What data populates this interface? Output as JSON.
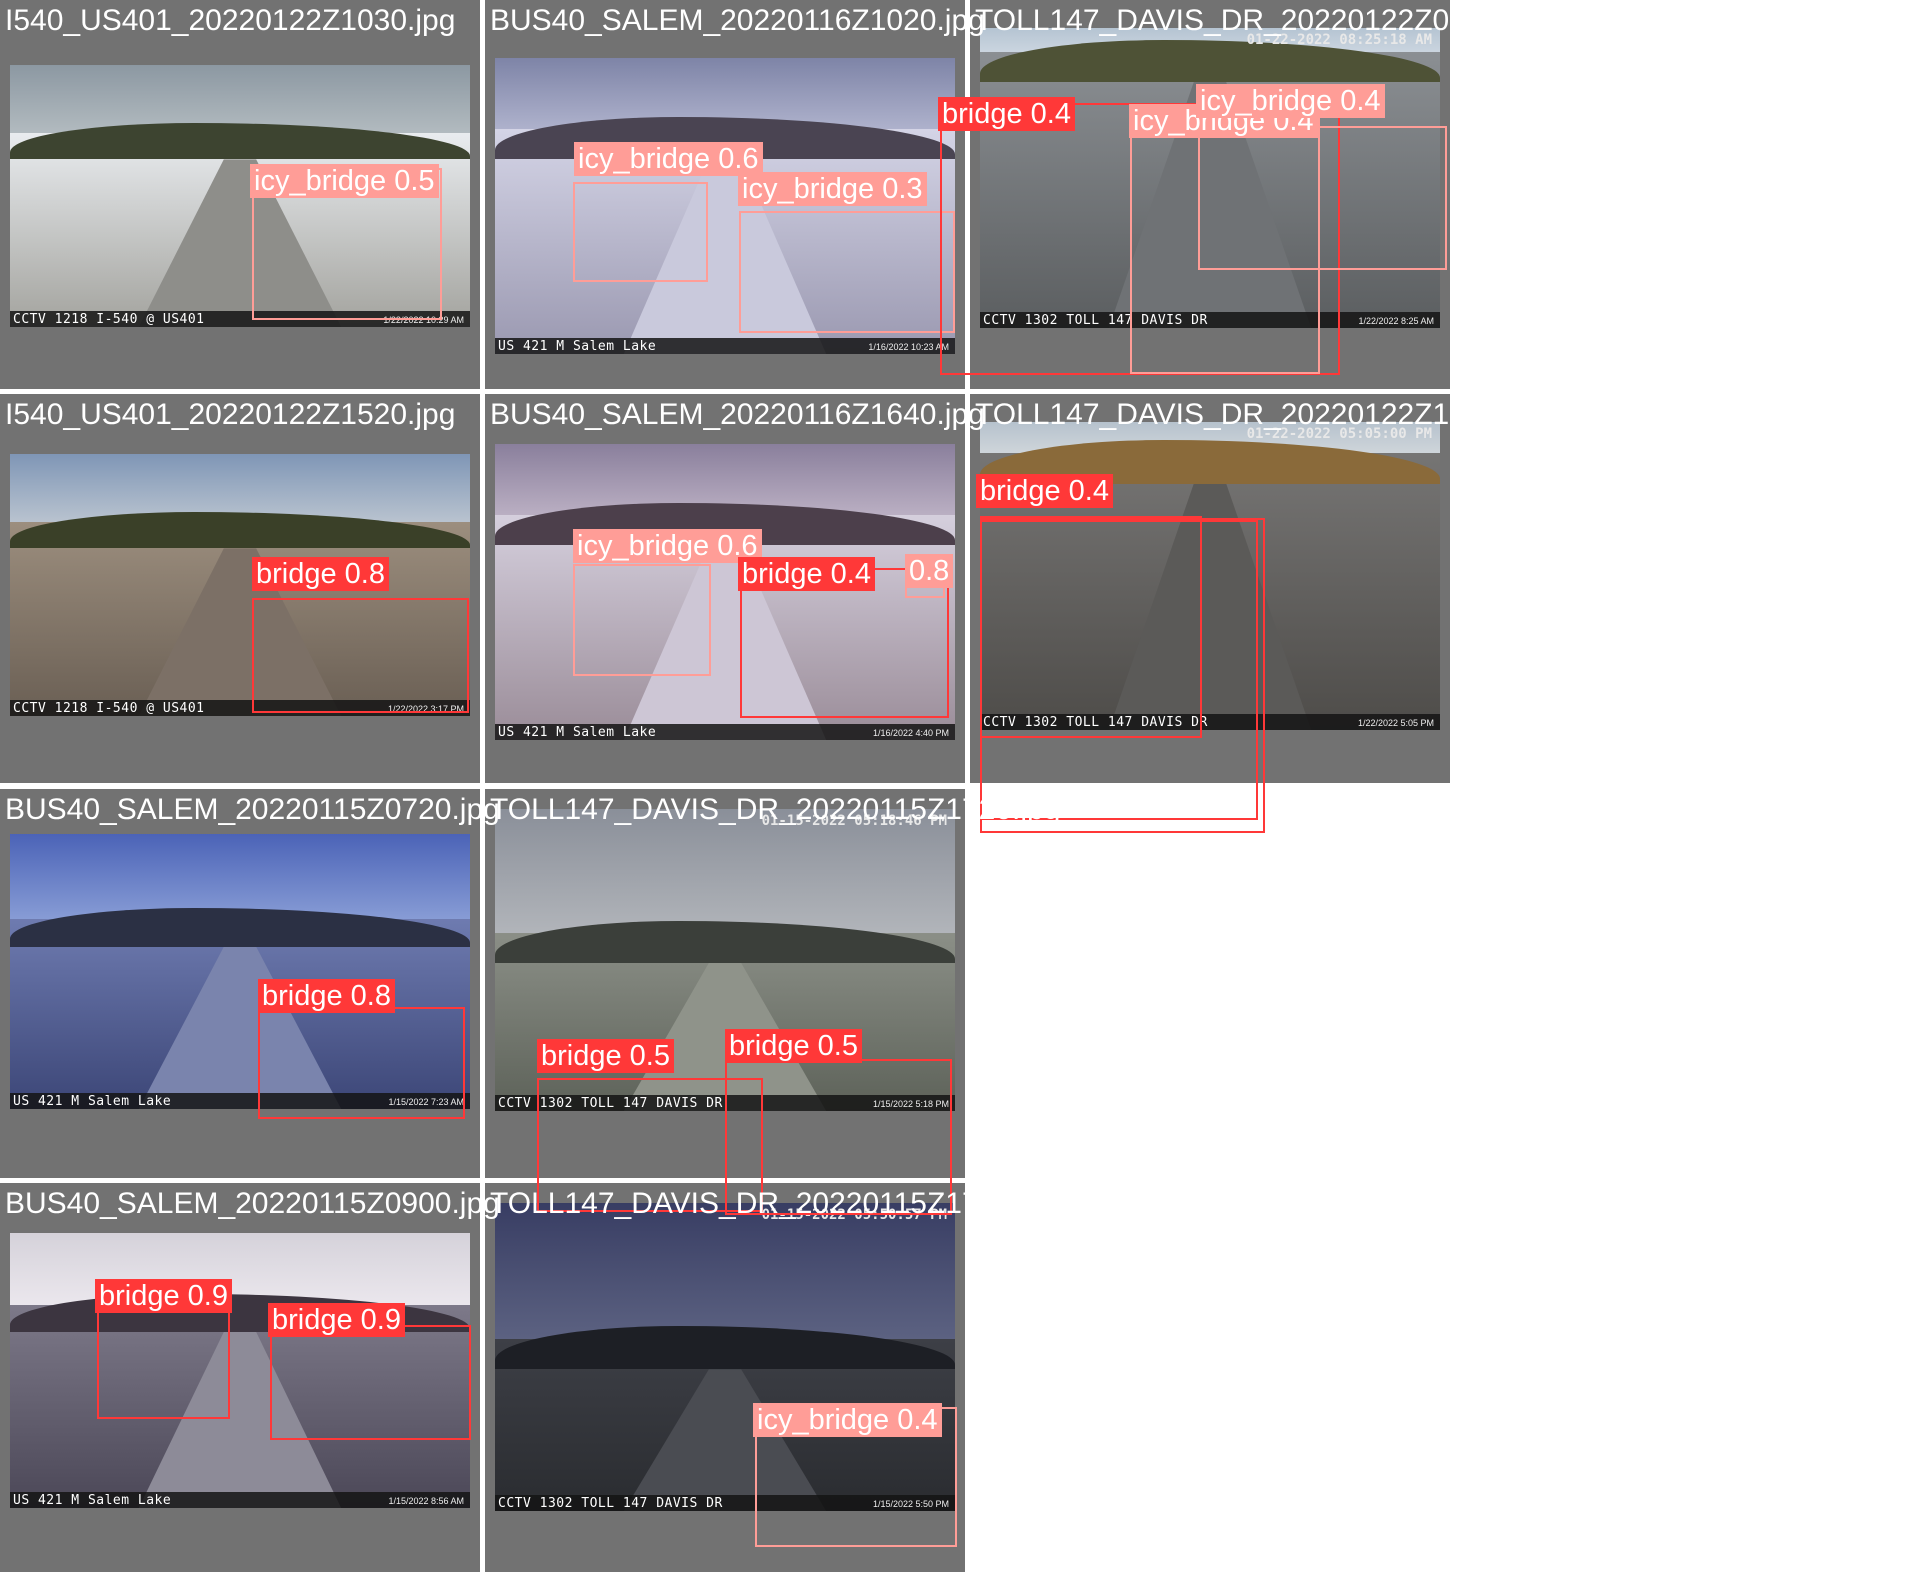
{
  "colors": {
    "bridge": "#ff3838",
    "icy_bridge": "#ff9d97",
    "tile_background": "#727272"
  },
  "tiles": [
    {
      "file": "I540_US401_20220122Z1030.jpg",
      "camera_label": "CCTV 1218 I-540 @ US401",
      "camera_time": "1/22/2022 10:29 AM",
      "camera_stamp": "",
      "detections": [
        {
          "label": "icy_bridge 0.5",
          "class": "icy_bridge",
          "confidence": 0.5
        }
      ]
    },
    {
      "file": "BUS40_SALEM_20220116Z1020.jpg",
      "camera_label": "US 421 M Salem Lake",
      "camera_time": "1/16/2022 10:23 AM",
      "camera_stamp": "",
      "detections": [
        {
          "label": "icy_bridge 0.6",
          "class": "icy_bridge",
          "confidence": 0.6
        },
        {
          "label": "icy_bridge 0.3",
          "class": "icy_bridge",
          "confidence": 0.3
        }
      ]
    },
    {
      "file": "TOLL147_DAVIS_DR_20220122Z0830.jpg",
      "camera_label": "CCTV 1302 TOLL 147 DAVIS DR",
      "camera_time": "1/22/2022 8:25 AM",
      "camera_stamp": "01-22-2022 08:25:18 AM",
      "detections": [
        {
          "label": "bridge 0.4",
          "class": "bridge",
          "confidence": 0.4
        },
        {
          "label": "icy_bridge 0.4",
          "class": "icy_bridge",
          "confidence": 0.4
        },
        {
          "label": "icy_bridge 0.4",
          "class": "icy_bridge",
          "confidence": 0.4
        }
      ]
    },
    {
      "file": "I540_US401_20220122Z1520.jpg",
      "camera_label": "CCTV 1218 I-540 @ US401",
      "camera_time": "1/22/2022 3:17 PM",
      "camera_stamp": "",
      "detections": [
        {
          "label": "bridge 0.8",
          "class": "bridge",
          "confidence": 0.8
        }
      ]
    },
    {
      "file": "BUS40_SALEM_20220116Z1640.jpg",
      "camera_label": "US 421 M Salem Lake",
      "camera_time": "1/16/2022 4:40 PM",
      "camera_stamp": "",
      "detections": [
        {
          "label": "icy_bridge 0.6",
          "class": "icy_bridge",
          "confidence": 0.6
        },
        {
          "label": "bridge 0.4",
          "class": "bridge",
          "confidence": 0.4
        },
        {
          "label": "0.8",
          "class": "icy_bridge",
          "confidence": 0.8
        }
      ]
    },
    {
      "file": "TOLL147_DAVIS_DR_20220122Z1710.jpg",
      "camera_label": "CCTV 1302 TOLL 147 DAVIS DR",
      "camera_time": "1/22/2022 5:05 PM",
      "camera_stamp": "01-22-2022 05:05:00 PM",
      "detections": [
        {
          "label": "bridge 0.4",
          "class": "bridge",
          "confidence": 0.4
        },
        {
          "label": "",
          "class": "bridge",
          "confidence": null
        },
        {
          "label": "",
          "class": "bridge",
          "confidence": null
        }
      ]
    },
    {
      "file": "BUS40_SALEM_20220115Z0720.jpg",
      "camera_label": "US 421 M Salem Lake",
      "camera_time": "1/15/2022 7:23 AM",
      "camera_stamp": "",
      "detections": [
        {
          "label": "bridge 0.8",
          "class": "bridge",
          "confidence": 0.8
        }
      ]
    },
    {
      "file": "TOLL147_DAVIS_DR_20220115Z1720.jpg",
      "camera_label": "CCTV 1302 TOLL 147 DAVIS DR",
      "camera_time": "1/15/2022 5:18 PM",
      "camera_stamp": "01-15-2022 05:18:46 PM",
      "detections": [
        {
          "label": "bridge 0.5",
          "class": "bridge",
          "confidence": 0.5
        },
        {
          "label": "bridge 0.5",
          "class": "bridge",
          "confidence": 0.5
        }
      ]
    },
    {
      "file": "BUS40_SALEM_20220115Z0900.jpg",
      "camera_label": "US 421 M Salem Lake",
      "camera_time": "1/15/2022 8:56 AM",
      "camera_stamp": "",
      "detections": [
        {
          "label": "bridge 0.9",
          "class": "bridge",
          "confidence": 0.9
        },
        {
          "label": "bridge 0.9",
          "class": "bridge",
          "confidence": 0.9
        }
      ]
    },
    {
      "file": "TOLL147_DAVIS_DR_20220115Z1755.jpg",
      "camera_label": "CCTV 1302 TOLL 147 DAVIS DR",
      "camera_time": "1/15/2022 5:50 PM",
      "camera_stamp": "01-15-2022 05:50:57 PM",
      "detections": [
        {
          "label": "icy_bridge 0.4",
          "class": "icy_bridge",
          "confidence": 0.4
        }
      ]
    }
  ]
}
